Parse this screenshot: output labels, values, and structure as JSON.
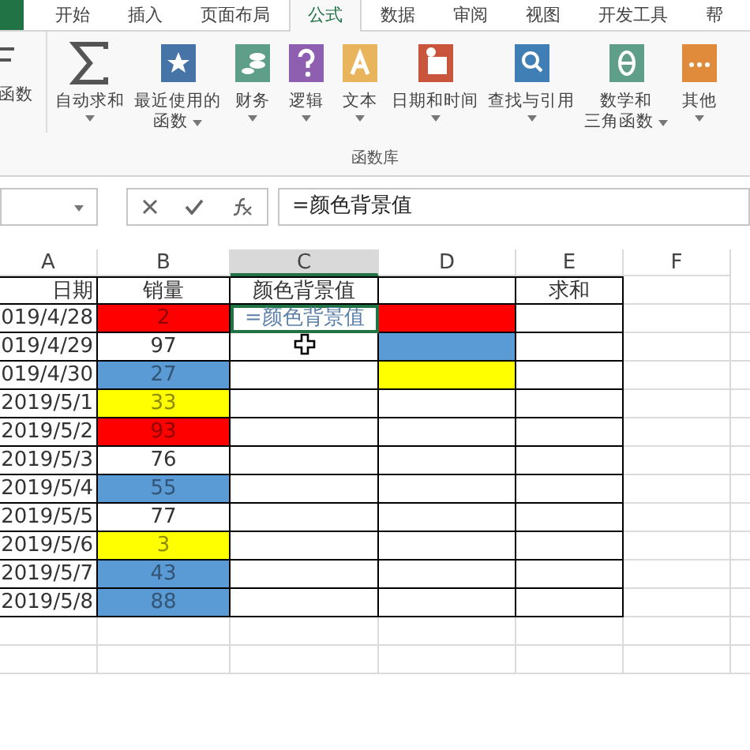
{
  "ribbon_tabs": [
    {
      "label": "开始",
      "selected": false
    },
    {
      "label": "插入",
      "selected": false
    },
    {
      "label": "页面布局",
      "selected": false
    },
    {
      "label": "公式",
      "selected": true
    },
    {
      "label": "数据",
      "selected": false
    },
    {
      "label": "审阅",
      "selected": false
    },
    {
      "label": "视图",
      "selected": false
    },
    {
      "label": "开发工具",
      "selected": false
    },
    {
      "label": "帮",
      "selected": false
    }
  ],
  "ribbon": {
    "buttons": [
      {
        "kind": "insert",
        "lines": [
          "函数"
        ],
        "dropdown": false
      },
      {
        "kind": "sigma",
        "lines": [
          "自动求和"
        ],
        "dropdown": true
      },
      {
        "kind": "star",
        "lines": [
          "最近使用的",
          "函数"
        ],
        "dropdown": true
      },
      {
        "kind": "coins",
        "lines": [
          "财务"
        ],
        "dropdown": true
      },
      {
        "kind": "question",
        "lines": [
          "逻辑"
        ],
        "dropdown": true
      },
      {
        "kind": "text",
        "lines": [
          "文本"
        ],
        "dropdown": true
      },
      {
        "kind": "calendar",
        "lines": [
          "日期和时间"
        ],
        "dropdown": true
      },
      {
        "kind": "search",
        "lines": [
          "查找与引用"
        ],
        "dropdown": true
      },
      {
        "kind": "theta",
        "lines": [
          "数学和",
          "三角函数"
        ],
        "dropdown": true
      },
      {
        "kind": "more",
        "lines": [
          "其他"
        ],
        "dropdown": true
      }
    ],
    "group_label": "函数库"
  },
  "formula_bar": {
    "formula": "=颜色背景值"
  },
  "sheet": {
    "columns": [
      {
        "label": "A",
        "selected": false
      },
      {
        "label": "B",
        "selected": false
      },
      {
        "label": "C",
        "selected": true
      },
      {
        "label": "D",
        "selected": false
      },
      {
        "label": "E",
        "selected": false
      },
      {
        "label": "F",
        "selected": false
      }
    ],
    "rows": [
      {
        "cells": [
          {
            "text": "日期"
          },
          {
            "text": "销量"
          },
          {
            "text": "颜色背景值"
          },
          {},
          {
            "text": "求和"
          }
        ]
      },
      {
        "cells": [
          {
            "text": "019/4/28"
          },
          {
            "text": "2",
            "color": "#ff0000"
          },
          {
            "text": "=颜色背景值",
            "editing": true
          },
          {
            "color": "#ff0000"
          },
          {}
        ]
      },
      {
        "cells": [
          {
            "text": "019/4/29"
          },
          {
            "text": "97"
          },
          {},
          {
            "color": "#5b9bd5"
          },
          {}
        ]
      },
      {
        "cells": [
          {
            "text": "019/4/30"
          },
          {
            "text": "27",
            "color": "#5b9bd5"
          },
          {},
          {
            "color": "#ffff00"
          },
          {}
        ]
      },
      {
        "cells": [
          {
            "text": "2019/5/1"
          },
          {
            "text": "33",
            "color": "#ffff00"
          },
          {},
          {},
          {}
        ]
      },
      {
        "cells": [
          {
            "text": "2019/5/2"
          },
          {
            "text": "93",
            "color": "#ff0000"
          },
          {},
          {},
          {}
        ]
      },
      {
        "cells": [
          {
            "text": "2019/5/3"
          },
          {
            "text": "76"
          },
          {},
          {},
          {}
        ]
      },
      {
        "cells": [
          {
            "text": "2019/5/4"
          },
          {
            "text": "55",
            "color": "#5b9bd5"
          },
          {},
          {},
          {}
        ]
      },
      {
        "cells": [
          {
            "text": "2019/5/5"
          },
          {
            "text": "77"
          },
          {},
          {},
          {}
        ]
      },
      {
        "cells": [
          {
            "text": "2019/5/6"
          },
          {
            "text": "3",
            "color": "#ffff00"
          },
          {},
          {},
          {}
        ]
      },
      {
        "cells": [
          {
            "text": "2019/5/7"
          },
          {
            "text": "43",
            "color": "#5b9bd5"
          },
          {},
          {},
          {}
        ]
      },
      {
        "cells": [
          {
            "text": "2019/5/8"
          },
          {
            "text": "88",
            "color": "#5b9bd5"
          },
          {},
          {},
          {}
        ]
      }
    ]
  }
}
